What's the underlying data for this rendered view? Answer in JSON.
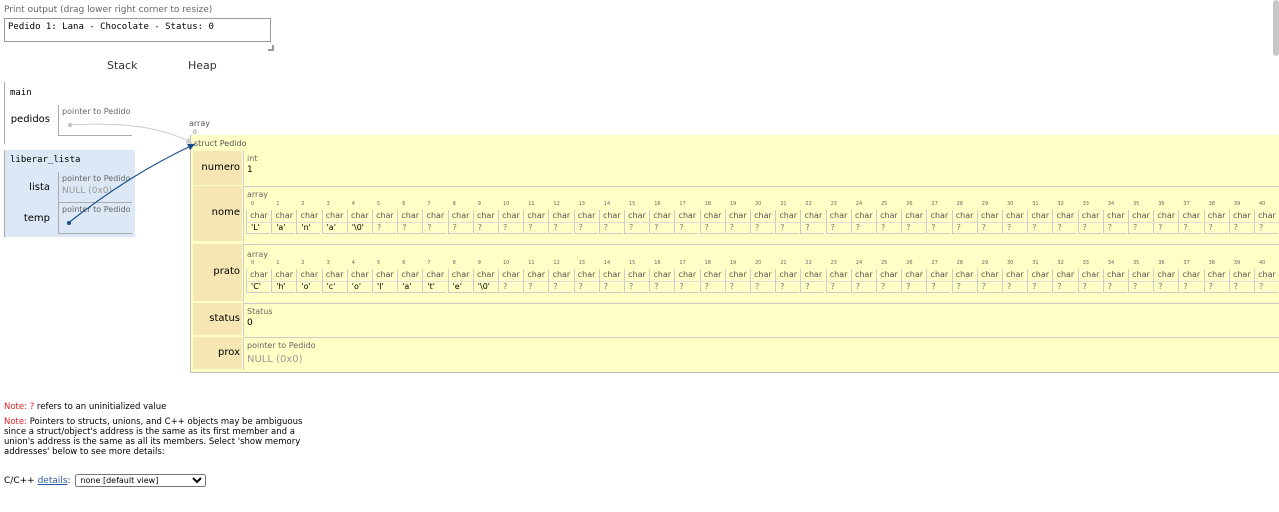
{
  "print_output": {
    "label": "Print output (drag lower right corner to resize)",
    "text": "Pedido 1: Lana - Chocolate - Status: 0"
  },
  "headers": {
    "stack": "Stack",
    "heap": "Heap"
  },
  "stack": {
    "main": {
      "name": "main",
      "vars": [
        {
          "name": "pedidos",
          "type": "pointer to Pedido",
          "value": ""
        }
      ]
    },
    "liberar_lista": {
      "name": "liberar_lista",
      "vars": [
        {
          "name": "lista",
          "type": "pointer to Pedido",
          "value": "NULL (0x0)"
        },
        {
          "name": "temp",
          "type": "pointer to Pedido",
          "value": ""
        }
      ]
    }
  },
  "heap": {
    "array_label": "array",
    "array_index": "0",
    "struct_label": "struct Pedido",
    "fields": {
      "numero": {
        "name": "numero",
        "type": "int",
        "value": "1"
      },
      "nome": {
        "name": "nome",
        "type": "array",
        "elem_type": "char",
        "values": [
          "'L'",
          "'a'",
          "'n'",
          "'a'",
          "'\\0'",
          "?",
          "?",
          "?",
          "?",
          "?",
          "?",
          "?",
          "?",
          "?",
          "?",
          "?",
          "?",
          "?",
          "?",
          "?",
          "?",
          "?",
          "?",
          "?",
          "?",
          "?",
          "?",
          "?",
          "?",
          "?",
          "?",
          "?",
          "?",
          "?",
          "?",
          "?",
          "?",
          "?",
          "?",
          "?",
          "?"
        ]
      },
      "prato": {
        "name": "prato",
        "type": "array",
        "elem_type": "char",
        "values": [
          "'C'",
          "'h'",
          "'o'",
          "'c'",
          "'o'",
          "'l'",
          "'a'",
          "'t'",
          "'e'",
          "'\\0'",
          "?",
          "?",
          "?",
          "?",
          "?",
          "?",
          "?",
          "?",
          "?",
          "?",
          "?",
          "?",
          "?",
          "?",
          "?",
          "?",
          "?",
          "?",
          "?",
          "?",
          "?",
          "?",
          "?",
          "?",
          "?",
          "?",
          "?",
          "?",
          "?",
          "?",
          "?"
        ]
      },
      "status": {
        "name": "status",
        "type": "Status",
        "value": "0"
      },
      "prox": {
        "name": "prox",
        "type": "pointer to Pedido",
        "value": "NULL (0x0)"
      }
    }
  },
  "notes": {
    "note_label": "Note:",
    "note1_mark": "?",
    "note1_text": "refers to an uninitialized value",
    "note2_text": "Pointers to structs, unions, and C++ objects may be ambiguous since a struct/object's address is the same as its first member and a union's address is the same as all its members. Select 'show memory addresses' below to see more details:"
  },
  "details": {
    "prefix": "C/C++",
    "link": "details",
    "colon": ":",
    "selected": "none [default view]"
  }
}
